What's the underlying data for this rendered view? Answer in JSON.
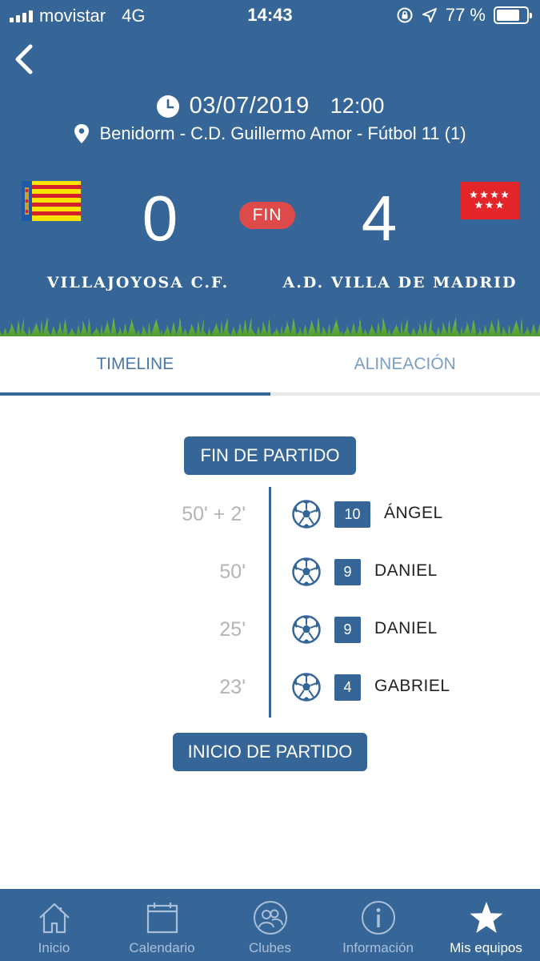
{
  "status_bar": {
    "carrier": "movistar",
    "network": "4G",
    "time": "14:43",
    "battery": "77 %",
    "battery_level": 0.77
  },
  "match": {
    "date": "03/07/2019",
    "time": "12:00",
    "venue": "Benidorm - C.D. Guillermo Amor - Fútbol 11 (1)",
    "status": "FIN",
    "home": {
      "name": "VILLAJOYOSA C.F.",
      "score": "0"
    },
    "away": {
      "name": "A.D. VILLA DE MADRID",
      "score": "4"
    }
  },
  "tabs": [
    {
      "label": "TIMELINE",
      "active": true
    },
    {
      "label": "ALINEACIÓN",
      "active": false
    }
  ],
  "timeline": {
    "end_label": "FIN DE PARTIDO",
    "start_label": "INICIO DE PARTIDO",
    "events": [
      {
        "minute": "50' + 2'",
        "number": "10",
        "player": "ÁNGEL",
        "icon": "soccer-ball-icon"
      },
      {
        "minute": "50'",
        "number": "9",
        "player": "DANIEL",
        "icon": "soccer-ball-icon"
      },
      {
        "minute": "25'",
        "number": "9",
        "player": "DANIEL",
        "icon": "soccer-ball-icon"
      },
      {
        "minute": "23'",
        "number": "4",
        "player": "GABRIEL",
        "icon": "soccer-ball-icon"
      }
    ]
  },
  "nav": [
    {
      "label": "Inicio",
      "icon": "home-icon",
      "active": false
    },
    {
      "label": "Calendario",
      "icon": "calendar-icon",
      "active": false
    },
    {
      "label": "Clubes",
      "icon": "clubs-icon",
      "active": false
    },
    {
      "label": "Información",
      "icon": "info-icon",
      "active": false
    },
    {
      "label": "Mis equipos",
      "icon": "star-icon",
      "active": true
    }
  ],
  "colors": {
    "primary": "#366697",
    "fin_badge": "#de4a4a",
    "minute_text": "#b5b5b5",
    "nav_inactive": "#a9c0da"
  }
}
